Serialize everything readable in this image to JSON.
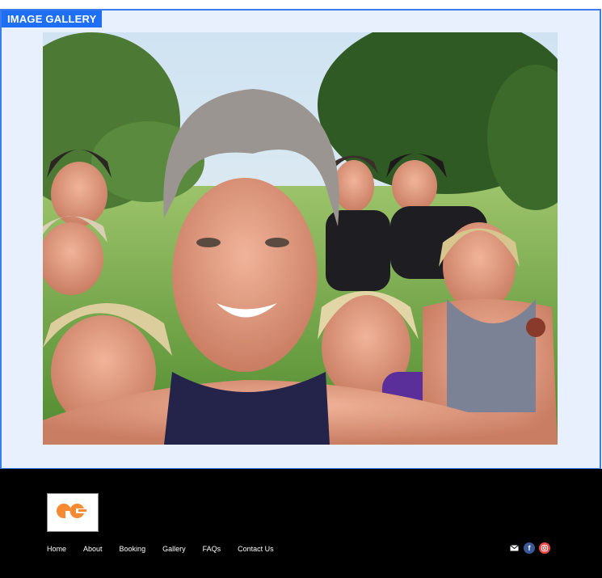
{
  "gallery": {
    "label": "IMAGE GALLERY"
  },
  "footer": {
    "nav": [
      "Home",
      "About",
      "Booking",
      "Gallery",
      "FAQs",
      "Contact Us"
    ],
    "social": [
      {
        "icon": "mail-icon",
        "color": "#000000"
      },
      {
        "icon": "facebook-icon",
        "color": "#3b5998"
      },
      {
        "icon": "instagram-icon",
        "color": "#e94b4b"
      }
    ],
    "brand_color": "#f58a32"
  }
}
